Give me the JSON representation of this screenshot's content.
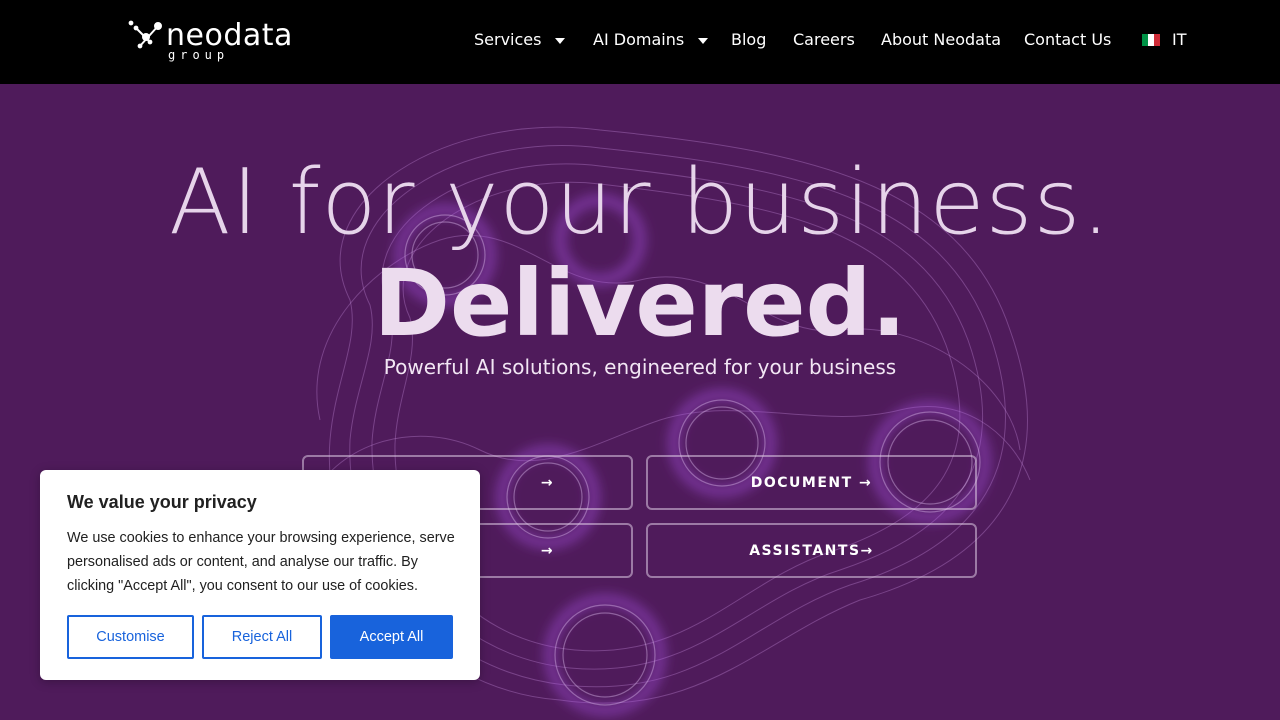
{
  "brand": {
    "name": "neodata",
    "tagline": "group"
  },
  "nav": {
    "items": [
      {
        "label": "Services",
        "dropdown": true
      },
      {
        "label": "AI Domains",
        "dropdown": true
      },
      {
        "label": "Blog",
        "dropdown": false
      },
      {
        "label": "Careers",
        "dropdown": false
      },
      {
        "label": "About Neodata",
        "dropdown": false
      },
      {
        "label": "Contact Us",
        "dropdown": false
      }
    ],
    "language": "IT"
  },
  "hero": {
    "headline": "AI for your business.",
    "emphasis": "Delivered.",
    "subtitle": "Powerful AI solutions, engineered for your business",
    "ctas": [
      {
        "label": "→"
      },
      {
        "label": "DOCUMENT →"
      },
      {
        "label": "→"
      },
      {
        "label": "ASSISTANTS→"
      }
    ]
  },
  "cookie_banner": {
    "title": "We value your privacy",
    "text": "We use cookies to enhance your browsing experience, serve personalised ads or content, and analyse our traffic. By clicking \"Accept All\", you consent to our use of cookies.",
    "customise_label": "Customise",
    "reject_label": "Reject All",
    "accept_label": "Accept All"
  },
  "colors": {
    "header_bg": "#000000",
    "hero_bg": "#4f1b5b",
    "accent_glow": "#9b3fd6",
    "cookie_button": "#1863dc"
  }
}
